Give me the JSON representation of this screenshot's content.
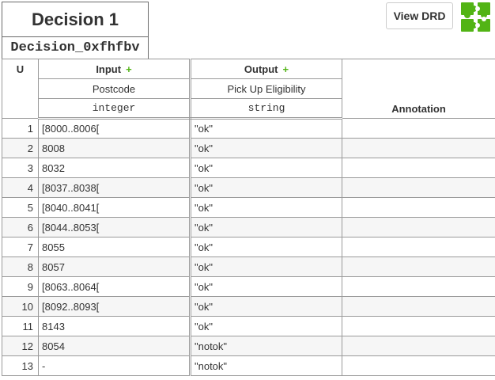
{
  "decision": {
    "name": "Decision 1",
    "id": "Decision_0xfhfbv"
  },
  "toolbar": {
    "view_drd_label": "View DRD",
    "logo_icon": "camunda-puzzle-logo-icon",
    "logo_color": "#52b415"
  },
  "table": {
    "hit_policy": "U",
    "input": {
      "label": "Input",
      "add_symbol": "+",
      "expression": "Postcode",
      "type": "integer"
    },
    "output": {
      "label": "Output",
      "add_symbol": "+",
      "name": "Pick Up Eligibility",
      "type": "string"
    },
    "annotation_label": "Annotation",
    "rules": [
      {
        "index": "1",
        "input": "[8000..8006[",
        "output": "\"ok\"",
        "annotation": ""
      },
      {
        "index": "2",
        "input": "8008",
        "output": "\"ok\"",
        "annotation": ""
      },
      {
        "index": "3",
        "input": "8032",
        "output": "\"ok\"",
        "annotation": ""
      },
      {
        "index": "4",
        "input": "[8037..8038[",
        "output": "\"ok\"",
        "annotation": ""
      },
      {
        "index": "5",
        "input": "[8040..8041[",
        "output": "\"ok\"",
        "annotation": ""
      },
      {
        "index": "6",
        "input": "[8044..8053[",
        "output": "\"ok\"",
        "annotation": ""
      },
      {
        "index": "7",
        "input": "8055",
        "output": "\"ok\"",
        "annotation": ""
      },
      {
        "index": "8",
        "input": "8057",
        "output": "\"ok\"",
        "annotation": ""
      },
      {
        "index": "9",
        "input": "[8063..8064[",
        "output": "\"ok\"",
        "annotation": ""
      },
      {
        "index": "10",
        "input": "[8092..8093[",
        "output": "\"ok\"",
        "annotation": ""
      },
      {
        "index": "11",
        "input": "8143",
        "output": "\"ok\"",
        "annotation": ""
      },
      {
        "index": "12",
        "input": "8054",
        "output": "\"notok\"",
        "annotation": ""
      },
      {
        "index": "13",
        "input": "-",
        "output": "\"notok\"",
        "annotation": ""
      }
    ]
  }
}
